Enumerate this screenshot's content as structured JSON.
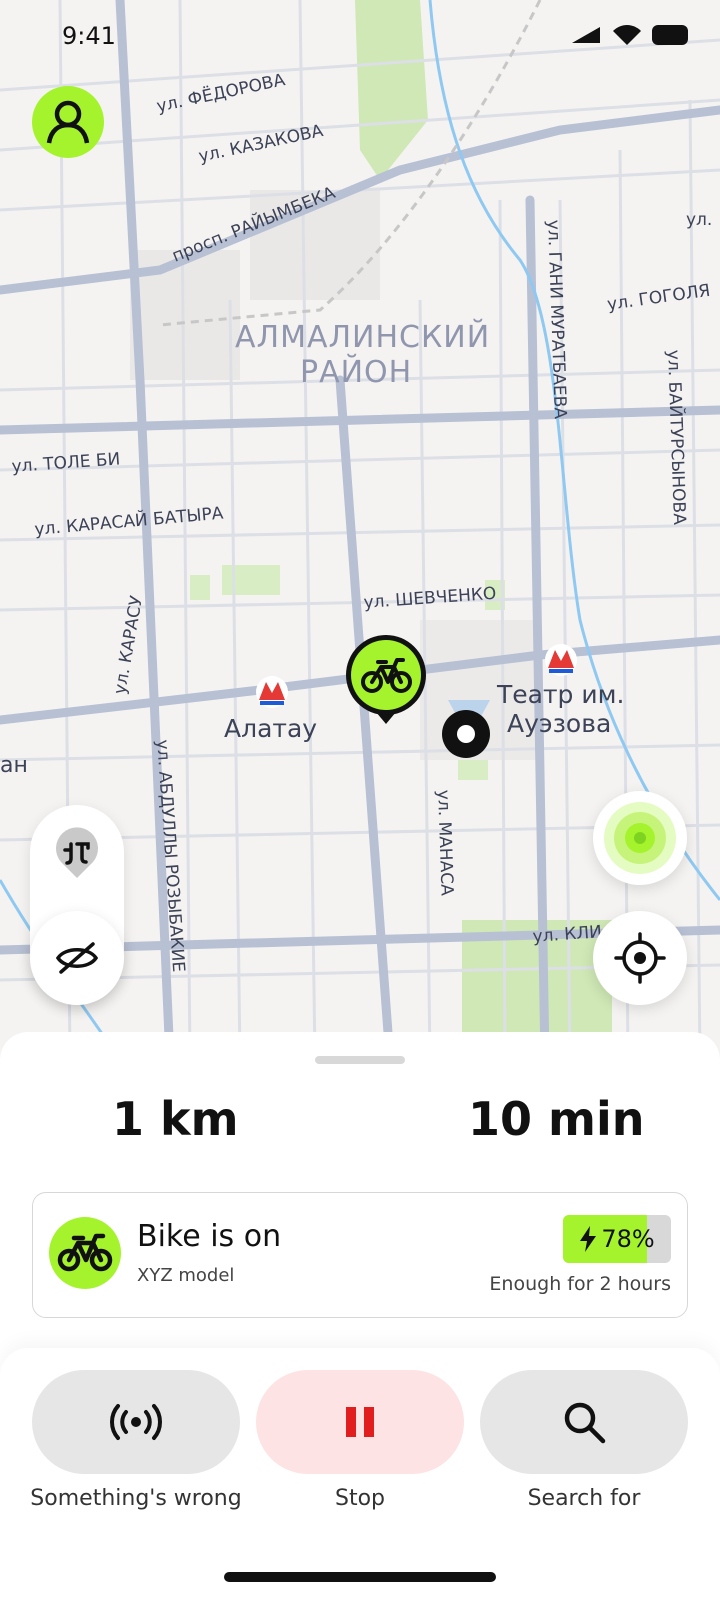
{
  "status_bar": {
    "time": "9:41"
  },
  "map": {
    "district": [
      "АЛМАЛИНСКИЙ",
      "РАЙОН"
    ],
    "streets": [
      "ул. ФЁДОРОВА",
      "ул. КАЗАКОВА",
      "просп. РАЙЫМБЕКА",
      "ул. ГАНИ МУРАТБАЕВА",
      "ул. ГОГОЛЯ",
      "ул. ТОЛЕ БИ",
      "ул. КАРАСАЙ БАТЫРА",
      "ул. ШЕВЧЕНКО",
      "ул. КАРАСУ",
      "ул. БАЙТУРСЫНОВА",
      "ул. АБДУЛЛЫ РОЗЫБАКИЕ",
      "ул. МАНАСА",
      "ул. КЛИ",
      "ул.",
      "ан"
    ],
    "stations": [
      "Алатау",
      "Театр им.",
      "Ауэзова"
    ]
  },
  "icons": {
    "profile": "person-icon",
    "route": "route-icon",
    "hide": "eye-off-icon",
    "radar": "radar-icon",
    "locate": "crosshair-icon",
    "bike_marker": "bike-icon",
    "user_location": "user-location-icon",
    "sos": "signal-icon",
    "stop": "pause-icon",
    "search": "search-icon",
    "charge": "lightning-icon"
  },
  "trip": {
    "distance": "1 km",
    "duration": "10 min"
  },
  "bike": {
    "status": "Bike is on",
    "model": "XYZ model",
    "battery_text": "78%",
    "battery_level": 0.78,
    "range": "Enough for 2 hours"
  },
  "actions": [
    {
      "label": "Something's wrong",
      "icon": "signal-icon"
    },
    {
      "label": "Stop",
      "icon": "pause-icon"
    },
    {
      "label": "Search for",
      "icon": "search-icon"
    }
  ],
  "colors": {
    "accent": "#a4f32d",
    "stop_bg": "#fde3e3",
    "stop_icon": "#e11d1d",
    "button_bg": "#e6e6e6"
  }
}
